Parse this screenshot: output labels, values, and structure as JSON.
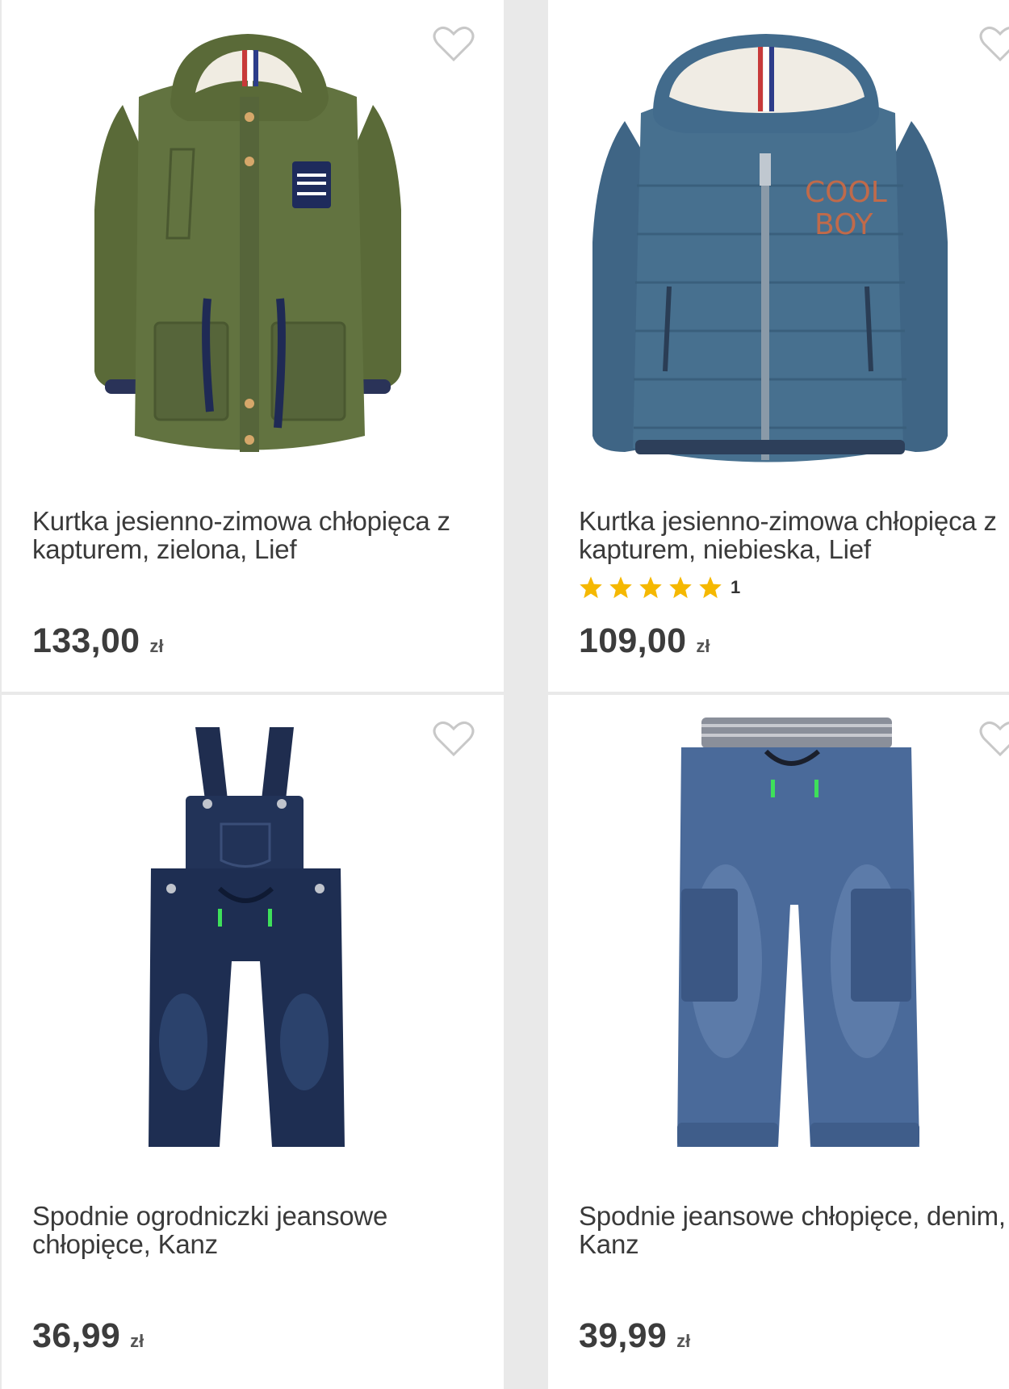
{
  "products": [
    {
      "title": "Kurtka jesienno-zimowa chłopięca z kapturem, zielona, Lief",
      "price": "133,00",
      "currency": "zł",
      "image": "green-parka-jacket",
      "wishlist_icon": "heart-outline-icon"
    },
    {
      "title": "Kurtka jesienno-zimowa chłopięca z kapturem, niebieska, Lief",
      "price": "109,00",
      "currency": "zł",
      "rating_stars": 5,
      "rating_count": "1",
      "image": "blue-puffer-jacket",
      "wishlist_icon": "heart-outline-icon"
    },
    {
      "title": "Spodnie ogrodniczki jeansowe chłopięce, Kanz",
      "price": "36,99",
      "currency": "zł",
      "image": "denim-dungarees",
      "wishlist_icon": "heart-outline-icon"
    },
    {
      "title": "Spodnie jeansowe chłopięce, denim, Kanz",
      "price": "39,99",
      "currency": "zł",
      "image": "denim-cargo-jeans",
      "wishlist_icon": "heart-outline-icon"
    }
  ],
  "colors": {
    "star": "#f5b800",
    "text": "#3a3a3a",
    "background": "#e9e9e9",
    "card": "#ffffff"
  }
}
